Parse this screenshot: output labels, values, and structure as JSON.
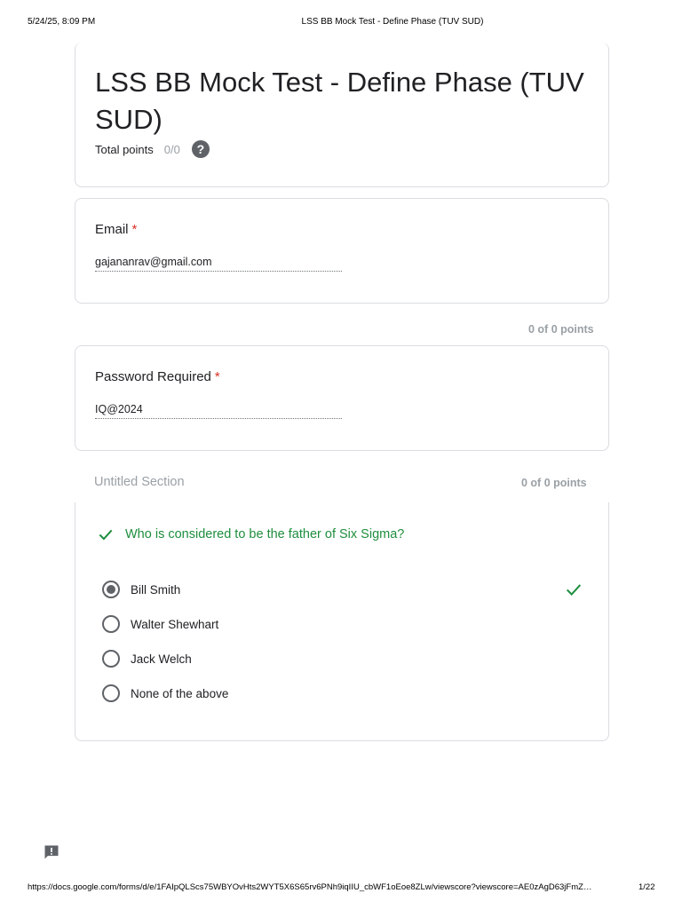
{
  "print_header": {
    "datetime": "5/24/25, 8:09 PM",
    "title": "LSS BB Mock Test - Define Phase (TUV SUD)"
  },
  "form": {
    "title": "LSS BB Mock Test - Define Phase (TUV SUD)",
    "total_points_label": "Total points",
    "total_points_value": "0/0",
    "help_icon": "help-circle-icon"
  },
  "email_field": {
    "label": "Email",
    "required_mark": "*",
    "value": "gajananrav@gmail.com"
  },
  "password_field": {
    "points": "0 of 0 points",
    "label": "Password Required",
    "required_mark": "*",
    "value": "IQ@2024"
  },
  "section": {
    "title": "Untitled Section",
    "points": "0 of 0 points"
  },
  "question": {
    "status_icon": "check-icon",
    "text": "Who is considered to be the father of Six Sigma?",
    "options": [
      {
        "label": "Bill Smith",
        "selected": true,
        "correct": true
      },
      {
        "label": "Walter Shewhart",
        "selected": false
      },
      {
        "label": "Jack Welch",
        "selected": false
      },
      {
        "label": "None of the above",
        "selected": false
      }
    ],
    "accent_color": "#1e8e3e"
  },
  "feedback": {
    "icon": "feedback-icon"
  },
  "print_footer": {
    "url": "https://docs.google.com/forms/d/e/1FAIpQLScs75WBYOvHts2WYT5X6S65rv6PNh9iqIIU_cbWF1oEoe8ZLw/viewscore?viewscore=AE0zAgD63jFmZ…",
    "page": "1/22"
  }
}
